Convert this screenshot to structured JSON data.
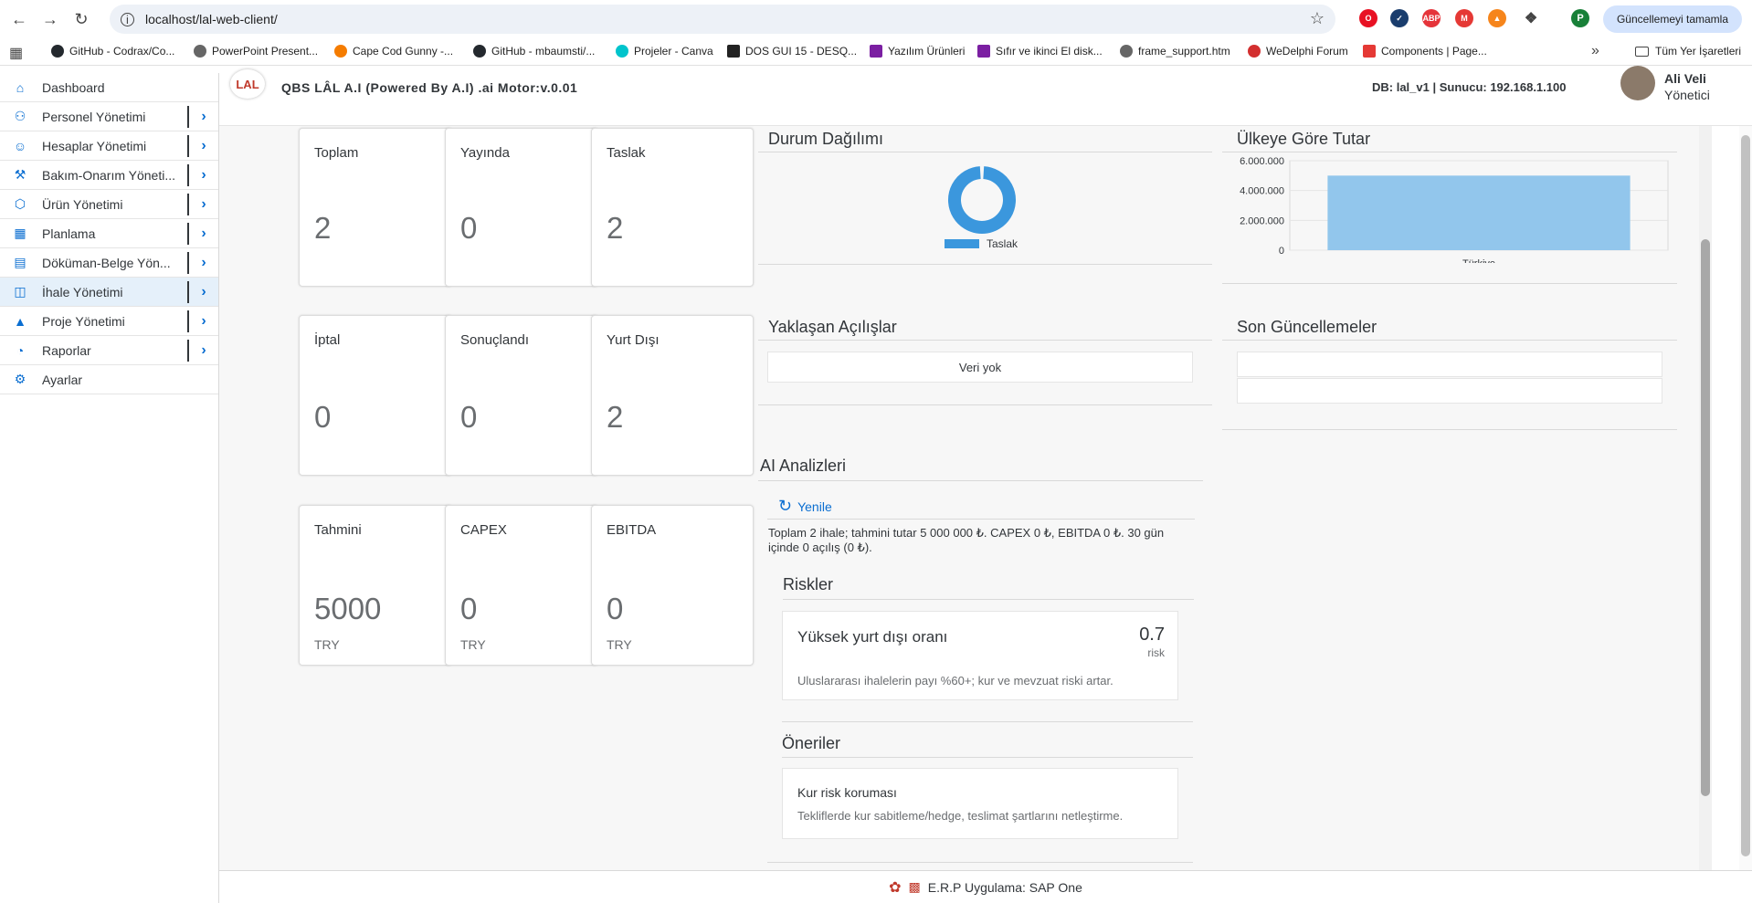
{
  "browser": {
    "url": "localhost/lal-web-client/",
    "update_label": "Güncellemeyi tamamla",
    "profile_initial": "P",
    "bookmarks": [
      "GitHub - Codrax/Co...",
      "PowerPoint Present...",
      "Cape Cod Gunny -...",
      "GitHub - mbaumsti/...",
      "Projeler - Canva",
      "DOS GUI 15 - DESQ...",
      "Yazılım Ürünleri",
      "Sıfır ve ikinci El disk...",
      "frame_support.htm",
      "WeDelphi Forum",
      "Components | Page..."
    ],
    "all_bookmarks": "Tüm Yer İşaretleri"
  },
  "header": {
    "logo": "LAL",
    "title": "QBS LÂL A.I (Powered By A.I) .ai Motor:v.0.01",
    "db_info": "DB: lal_v1 | Sunucu: 192.168.1.100",
    "user_name": "Ali Veli",
    "user_role": "Yönetici"
  },
  "sidebar": {
    "items": [
      {
        "label": "Dashboard",
        "icon": "home-icon",
        "expandable": false
      },
      {
        "label": "Personel Yönetimi",
        "icon": "people-icon",
        "expandable": true
      },
      {
        "label": "Hesaplar Yönetimi",
        "icon": "user-settings-icon",
        "expandable": true
      },
      {
        "label": "Bakım-Onarım Yöneti...",
        "icon": "wrench-icon",
        "expandable": true
      },
      {
        "label": "Ürün Yönetimi",
        "icon": "product-icon",
        "expandable": true
      },
      {
        "label": "Planlama",
        "icon": "calendar-icon",
        "expandable": true
      },
      {
        "label": "Döküman-Belge Yön...",
        "icon": "document-icon",
        "expandable": true
      },
      {
        "label": "İhale Yönetimi",
        "icon": "tender-icon",
        "expandable": true
      },
      {
        "label": "Proje Yönetimi",
        "icon": "project-icon",
        "expandable": true
      },
      {
        "label": "Raporlar",
        "icon": "pie-chart-icon",
        "expandable": true
      },
      {
        "label": "Ayarlar",
        "icon": "gear-icon",
        "expandable": false
      }
    ]
  },
  "tiles": [
    {
      "label": "Toplam",
      "value": "2",
      "unit": ""
    },
    {
      "label": "Yayında",
      "value": "0",
      "unit": ""
    },
    {
      "label": "Taslak",
      "value": "2",
      "unit": ""
    },
    {
      "label": "İptal",
      "value": "0",
      "unit": ""
    },
    {
      "label": "Sonuçlandı",
      "value": "0",
      "unit": ""
    },
    {
      "label": "Yurt Dışı",
      "value": "2",
      "unit": ""
    },
    {
      "label": "Tahmini",
      "value": "5000",
      "unit": "TRY"
    },
    {
      "label": "CAPEX",
      "value": "0",
      "unit": "TRY"
    },
    {
      "label": "EBITDA",
      "value": "0",
      "unit": "TRY"
    }
  ],
  "panels": {
    "status_distribution": "Durum Dağılımı",
    "by_country": "Ülkeye Göre Tutar",
    "upcoming": "Yaklaşan Açılışlar",
    "upcoming_empty": "Veri yok",
    "recent_updates": "Son Güncellemeler",
    "ai_analysis": "AI Analizleri",
    "refresh": "Yenile",
    "ai_summary": "Toplam 2 ihale; tahmini tutar 5 000 000 ₺. CAPEX 0 ₺, EBITDA 0 ₺. 30 gün içinde 0 açılış (0 ₺).",
    "risks_title": "Riskler",
    "risk": {
      "title": "Yüksek yurt dışı oranı",
      "score": "0.7",
      "score_label": "risk",
      "description": "Uluslararası ihalelerin payı %60+; kur ve mevzuat riski artar."
    },
    "recommendations_title": "Öneriler",
    "recommendation": {
      "title": "Kur risk koruması",
      "description": "Tekliflerde kur sabitleme/hedge, teslimat şartlarını netleştirme."
    }
  },
  "footer": "E.R.P Uygulama: SAP One",
  "colors": {
    "accent": "#0a6ed1",
    "chart_fill": "#92c6ec",
    "donut": "#3b97dd"
  },
  "chart_data": [
    {
      "type": "pie",
      "categories": [
        "Taslak"
      ],
      "values": [
        2
      ],
      "legend": "bottom"
    },
    {
      "type": "bar",
      "categories": [
        "Türkiye"
      ],
      "values": [
        5000000
      ],
      "yticks": [
        "0",
        "2.000.000",
        "4.000.000",
        "6.000.000"
      ],
      "ylim": [
        0,
        6000000
      ],
      "grid": true
    }
  ]
}
